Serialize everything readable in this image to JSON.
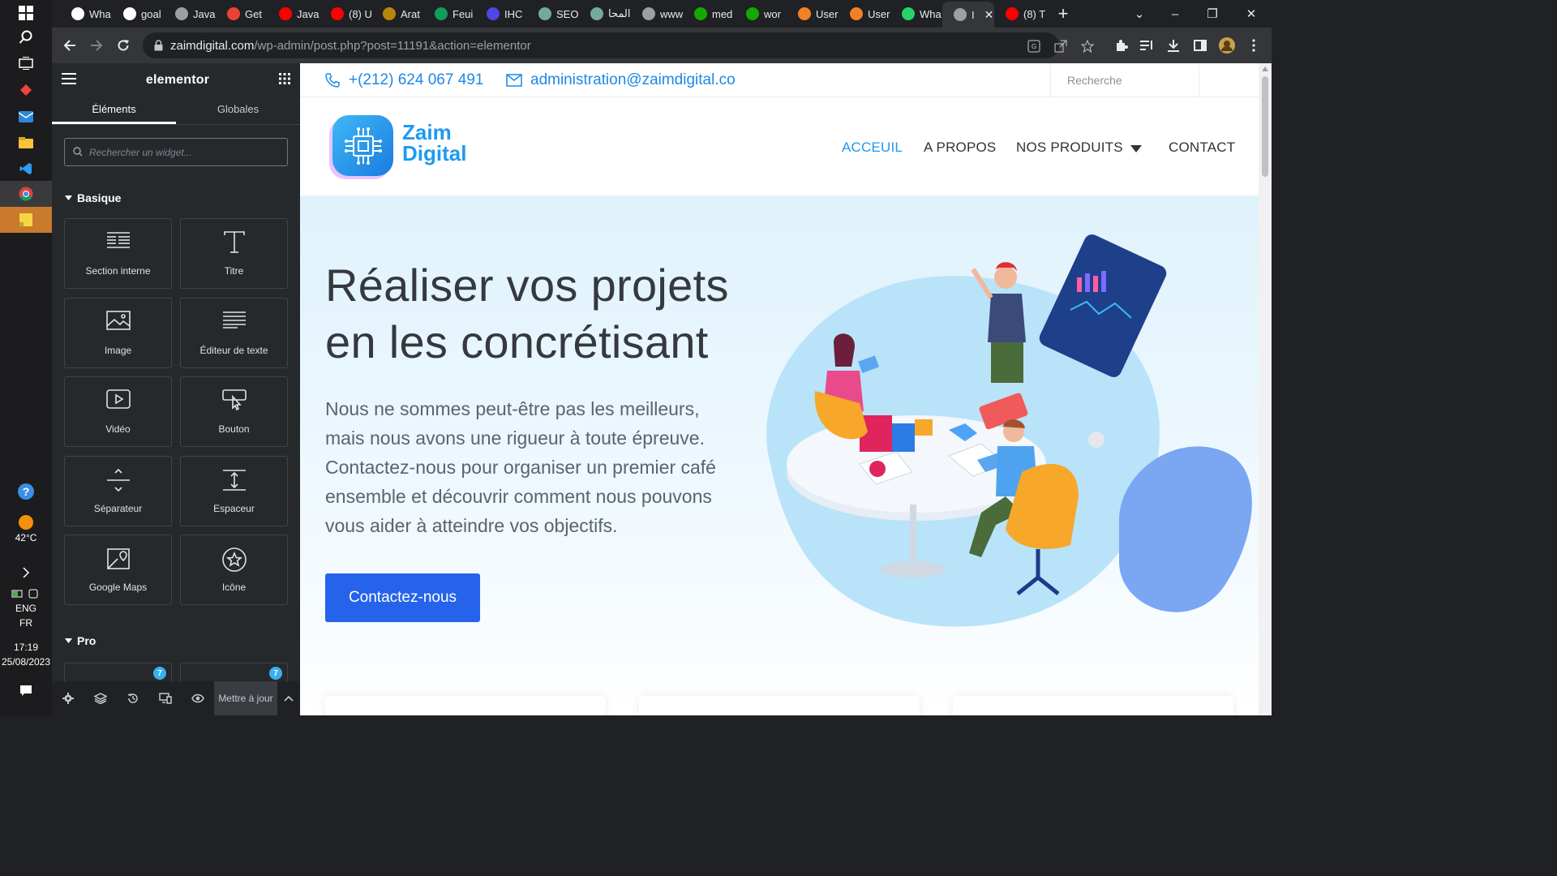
{
  "taskbar": {
    "weather_temp": "42°C",
    "lang_primary": "ENG",
    "lang_secondary": "FR",
    "time": "17:19",
    "date": "25/08/2023"
  },
  "browser": {
    "tabs": [
      {
        "label": "Wha",
        "icon": "github-icon",
        "color": "#ffffff"
      },
      {
        "label": "goal",
        "icon": "bookmark-icon",
        "color": "#ffffff"
      },
      {
        "label": "Java",
        "icon": "globe-icon",
        "color": "#9aa0a6"
      },
      {
        "label": "Get",
        "icon": "flag-icon",
        "color": "#ea4335"
      },
      {
        "label": "Java",
        "icon": "youtube-icon",
        "color": "#ff0000"
      },
      {
        "label": "(8) U",
        "icon": "youtube-icon",
        "color": "#ff0000"
      },
      {
        "label": "Arat",
        "icon": "coin-icon",
        "color": "#b8860b"
      },
      {
        "label": "Feui",
        "icon": "sheets-icon",
        "color": "#0f9d58"
      },
      {
        "label": "IHC",
        "icon": "c-icon",
        "color": "#4f46e5"
      },
      {
        "label": "SEO",
        "icon": "openai-icon",
        "color": "#74aa9c"
      },
      {
        "label": "المحا",
        "icon": "openai-icon",
        "color": "#74aa9c"
      },
      {
        "label": "www",
        "icon": "globe-icon",
        "color": "#9aa0a6"
      },
      {
        "label": "med",
        "icon": "upwork-icon",
        "color": "#14a800"
      },
      {
        "label": "wor",
        "icon": "upwork-icon",
        "color": "#14a800"
      },
      {
        "label": "User",
        "icon": "stackoverflow-icon",
        "color": "#f48024"
      },
      {
        "label": "User",
        "icon": "stackoverflow-icon",
        "color": "#f48024"
      },
      {
        "label": "Wha",
        "icon": "whatsapp-icon",
        "color": "#25d366"
      },
      {
        "label": "I",
        "icon": "globe-icon",
        "color": "#9aa0a6",
        "active": true
      },
      {
        "label": "(8) T",
        "icon": "youtube-icon",
        "color": "#ff0000"
      }
    ],
    "url_domain": "zaimdigital.com",
    "url_path": "/wp-admin/post.php?post=11191&action=elementor"
  },
  "elementor": {
    "logo": "elementor",
    "tab_elements": "Éléments",
    "tab_globals": "Globales",
    "search_placeholder": "Rechercher un widget...",
    "category_basic": "Basique",
    "category_pro": "Pro",
    "widgets": [
      {
        "label": "Section interne",
        "icon": "section-icon"
      },
      {
        "label": "Titre",
        "icon": "heading-icon"
      },
      {
        "label": "Image",
        "icon": "image-icon"
      },
      {
        "label": "Éditeur de texte",
        "icon": "text-editor-icon"
      },
      {
        "label": "Vidéo",
        "icon": "video-icon"
      },
      {
        "label": "Bouton",
        "icon": "button-icon"
      },
      {
        "label": "Séparateur",
        "icon": "divider-icon"
      },
      {
        "label": "Espaceur",
        "icon": "spacer-icon"
      },
      {
        "label": "Google Maps",
        "icon": "map-icon"
      },
      {
        "label": "Icône",
        "icon": "star-icon"
      }
    ],
    "pro_badge": "7",
    "footer_update": "Mettre à jour"
  },
  "site": {
    "phone": "+(212) 624 067 491",
    "email": "administration@zaimdigital.co",
    "search_placeholder": "Recherche",
    "logo_line1": "Zaim",
    "logo_line2": "Digital",
    "menu": [
      "ACCEUIL",
      "A PROPOS",
      "NOS PRODUITS",
      "CONTACT"
    ],
    "hero_title": "Réaliser vos projets en les concrétisant",
    "hero_text": "Nous ne sommes peut-être pas les meilleurs, mais nous avons une rigueur à toute épreuve. Contactez-nous pour organiser un premier café ensemble et découvrir comment nous pouvons vous aider à atteindre vos objectifs.",
    "cta_label": "Contactez-nous",
    "accent": "#1e9af0",
    "cta_color": "#2563eb"
  }
}
